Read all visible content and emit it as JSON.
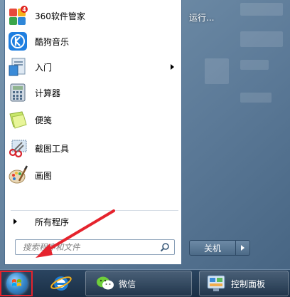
{
  "start_menu": {
    "programs": [
      {
        "label": "360软件管家",
        "icon": "360-software-manager-icon",
        "badge": "4",
        "has_submenu": false
      },
      {
        "label": "酷狗音乐",
        "icon": "kugou-music-icon",
        "has_submenu": false
      },
      {
        "label": "入门",
        "icon": "getting-started-icon",
        "has_submenu": true
      },
      {
        "label": "计算器",
        "icon": "calculator-icon",
        "has_submenu": false
      },
      {
        "label": "便笺",
        "icon": "sticky-notes-icon",
        "has_submenu": false
      },
      {
        "label": "截图工具",
        "icon": "snipping-tool-icon",
        "has_submenu": false
      },
      {
        "label": "画图",
        "icon": "paint-icon",
        "has_submenu": false
      }
    ],
    "all_programs_label": "所有程序",
    "search_placeholder": "搜索程序和文件",
    "right_pane": {
      "run_label": "运行..."
    },
    "shutdown_label": "关机"
  },
  "taskbar": {
    "items": [
      {
        "label": "",
        "icon": "ie-icon"
      },
      {
        "label": "微信",
        "icon": "wechat-icon"
      },
      {
        "label": "控制面板",
        "icon": "control-panel-icon"
      }
    ]
  },
  "colors": {
    "highlight_red": "#e5232d",
    "taskbar": "#1f3650",
    "menu_frame": "#6f8eaa"
  }
}
